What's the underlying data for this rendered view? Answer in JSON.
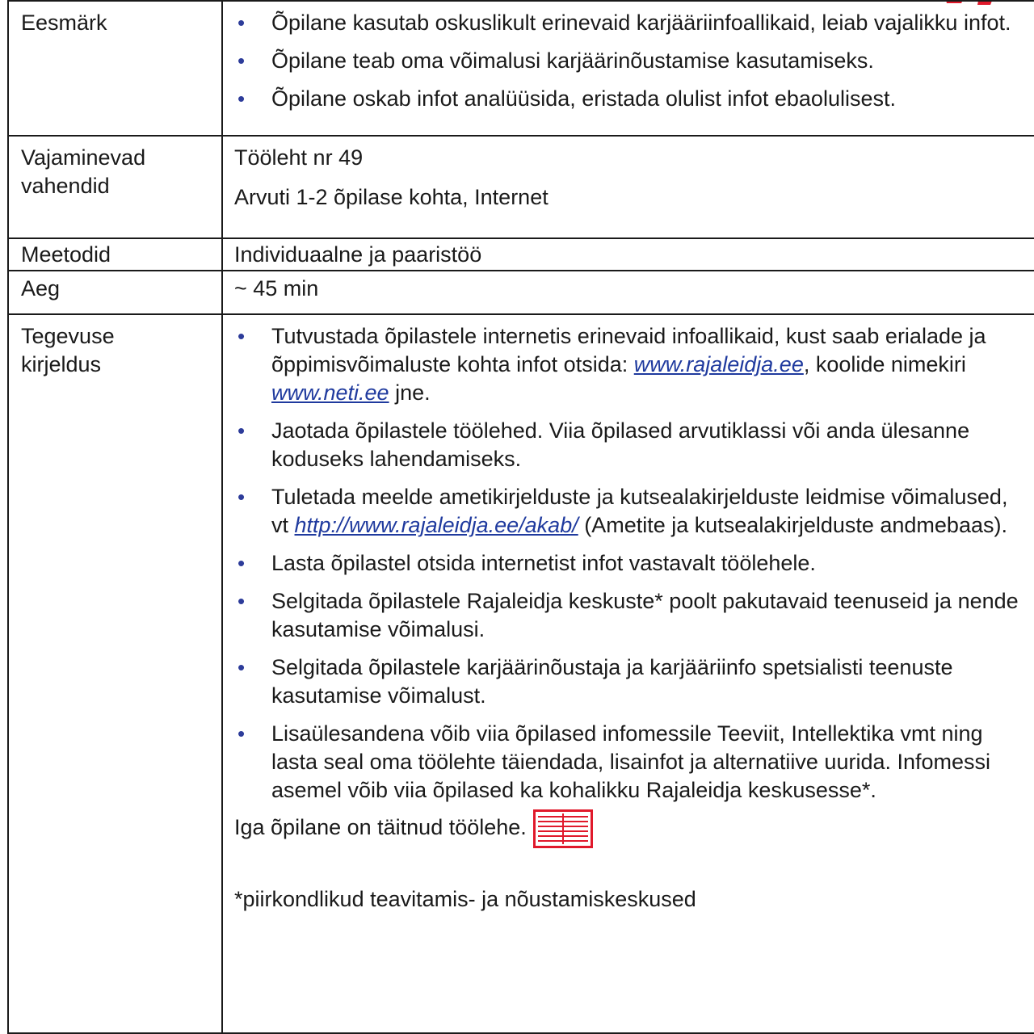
{
  "accent_red": "#e0192b",
  "bullet_color": "#2d3c9a",
  "link_color": "#1f3a9e",
  "rows": {
    "eesmark": {
      "label": "Eesmärk",
      "bullets": [
        "Õpilane kasutab oskuslikult erinevaid karjääriinfoallikaid, leiab vajalikku infot.",
        "Õpilane teab oma võimalusi karjäärinõustamise kasutamiseks.",
        "Õpilane oskab infot analüüsida, eristada olulist infot ebaolulisest."
      ]
    },
    "vahendid": {
      "label_line1": "Vajaminevad",
      "label_line2": "vahendid",
      "line1": "Tööleht nr 49",
      "line2": "Arvuti 1-2 õpilase kohta, Internet"
    },
    "meetodid": {
      "label": "Meetodid",
      "value": "Individuaalne ja paaristöö"
    },
    "aeg": {
      "label": "Aeg",
      "value": "~ 45 min"
    },
    "tegevus": {
      "label_line1": "Tegevuse",
      "label_line2": "kirjeldus",
      "b1_text1": "Tutvustada õpilastele internetis erinevaid infoallikaid, kust saab erialade ja õppimisvõimaluste kohta infot otsida: ",
      "b1_link1": "www.rajaleidja.ee",
      "b1_text2": ", koolide nimekiri ",
      "b1_link2": "www.neti.ee",
      "b1_text3": " jne.",
      "b2": "Jaotada õpilastele töölehed. Viia õpilased arvutiklassi või anda ülesanne koduseks lahendamiseks.",
      "b3_text1": "Tuletada meelde ametikirjelduste ja kutsealakirjelduste leidmise võimalused, vt  ",
      "b3_link": "http://www.rajaleidja.ee/akab/",
      "b3_text2": " (Ametite ja kutsealakirjelduste andmebaas).",
      "b4": "Lasta õpilastel otsida internetist infot vastavalt töölehele.",
      "b5": "Selgitada õpilastele Rajaleidja keskuste* poolt pakutavaid teenuseid ja nende kasutamise võimalusi.",
      "b6": "Selgitada õpilastele karjäärinõustaja ja karjääriinfo spetsialisti teenuste kasutamise võimalust.",
      "b7": "Lisaülesandena võib viia õpilased infomessile Teeviit, Intellektika vmt ning lasta seal oma töölehte täiendada, lisainfot ja alternatiive uurida. Infomessi asemel võib viia õpilased ka kohalikku Rajaleidja keskusesse*.",
      "outcome": "Iga õpilane on täitnud töölehe.",
      "outcome_icon": "worksheet-icon",
      "footnote": "*piirkondlikud teavitamis- ja nõustamiskeskused"
    }
  }
}
